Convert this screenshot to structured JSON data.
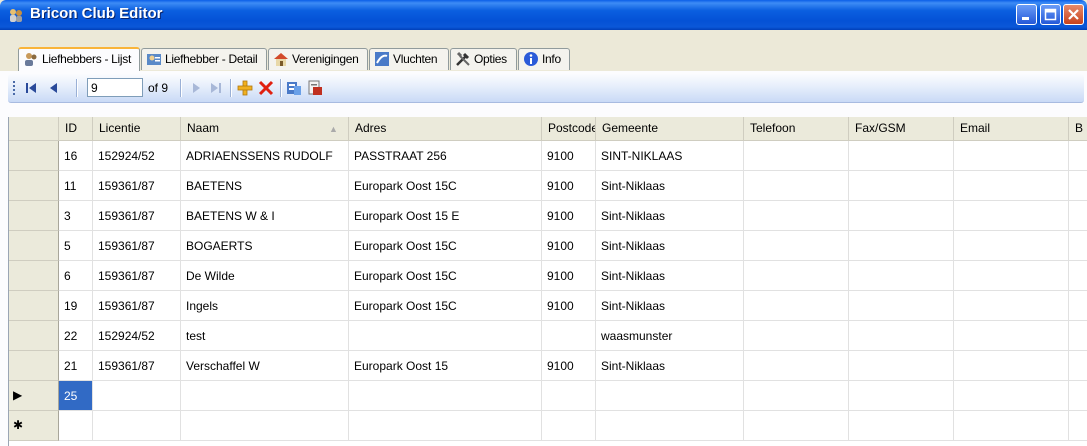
{
  "window": {
    "title": "Bricon Club Editor"
  },
  "tabs": [
    {
      "label": "Liefhebbers - Lijst",
      "icon": "users-icon",
      "active": true
    },
    {
      "label": "Liefhebber - Detail",
      "icon": "user-detail-icon",
      "active": false
    },
    {
      "label": "Verenigingen",
      "icon": "club-house-icon",
      "active": false
    },
    {
      "label": "Vluchten",
      "icon": "flights-icon",
      "active": false
    },
    {
      "label": "Opties",
      "icon": "tools-icon",
      "active": false
    },
    {
      "label": "Info",
      "icon": "info-icon",
      "active": false
    }
  ],
  "navigator": {
    "position": "9",
    "count_label": "of 9"
  },
  "grid": {
    "columns": [
      "ID",
      "Licentie",
      "Naam",
      "Adres",
      "Postcode",
      "Gemeente",
      "Telefoon",
      "Fax/GSM",
      "Email",
      "B"
    ],
    "sorted_column": "Naam",
    "rows": [
      [
        "16",
        "152924/52",
        "ADRIAENSSENS RUDOLF",
        "PASSTRAAT 256",
        "9100",
        "SINT-NIKLAAS",
        "",
        "",
        ""
      ],
      [
        "11",
        "159361/87",
        "BAETENS",
        "Europark Oost 15C",
        "9100",
        "Sint-Niklaas",
        "",
        "",
        ""
      ],
      [
        "3",
        "159361/87",
        "BAETENS W & I",
        "Europark Oost 15 E",
        "9100",
        "Sint-Niklaas",
        "",
        "",
        ""
      ],
      [
        "5",
        "159361/87",
        "BOGAERTS",
        "Europark Oost 15C",
        "9100",
        "Sint-Niklaas",
        "",
        "",
        ""
      ],
      [
        "6",
        "159361/87",
        "De Wilde",
        "Europark Oost 15C",
        "9100",
        "Sint-Niklaas",
        "",
        "",
        ""
      ],
      [
        "19",
        "159361/87",
        "Ingels",
        "Europark Oost 15C",
        "9100",
        "Sint-Niklaas",
        "",
        "",
        ""
      ],
      [
        "22",
        "152924/52",
        "test",
        "",
        "",
        "waasmunster",
        "",
        "",
        ""
      ],
      [
        "21",
        "159361/87",
        "Verschaffel W",
        "Europark Oost 15",
        "9100",
        "Sint-Niklaas",
        "",
        "",
        ""
      ],
      [
        "25",
        "",
        "",
        "",
        "",
        "",
        "",
        "",
        ""
      ],
      [
        "",
        "",
        "",
        "",
        "",
        "",
        "",
        "",
        ""
      ]
    ],
    "row_markers": [
      "",
      "",
      "",
      "",
      "",
      "",
      "",
      "",
      "▶",
      "✱"
    ]
  }
}
